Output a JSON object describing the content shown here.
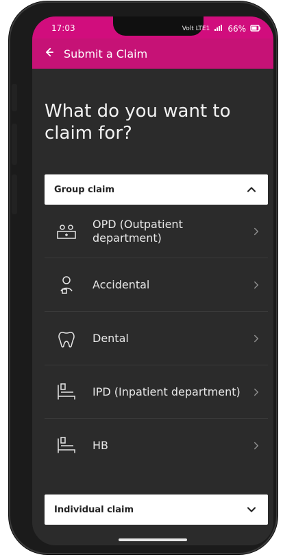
{
  "status": {
    "time": "17:03",
    "right_text": "Volt LTE1",
    "battery": "66%"
  },
  "appbar": {
    "title": "Submit a Claim",
    "back_icon": "arrow-left-icon"
  },
  "main": {
    "heading": "What do you want to claim for?",
    "group_claim": {
      "title": "Group claim",
      "expanded": true,
      "items": [
        {
          "label": "OPD (Outpatient department)",
          "icon": "outpatient-icon"
        },
        {
          "label": "Accidental",
          "icon": "doctor-icon"
        },
        {
          "label": "Dental",
          "icon": "tooth-icon"
        },
        {
          "label": "IPD (Inpatient department)",
          "icon": "hospital-bed-icon"
        },
        {
          "label": "HB",
          "icon": "hospital-bed-icon"
        }
      ]
    },
    "individual_claim": {
      "title": "Individual claim",
      "expanded": false
    }
  },
  "colors": {
    "accent": "#c61276",
    "background": "#2b2b2b",
    "card": "#ffffff"
  }
}
